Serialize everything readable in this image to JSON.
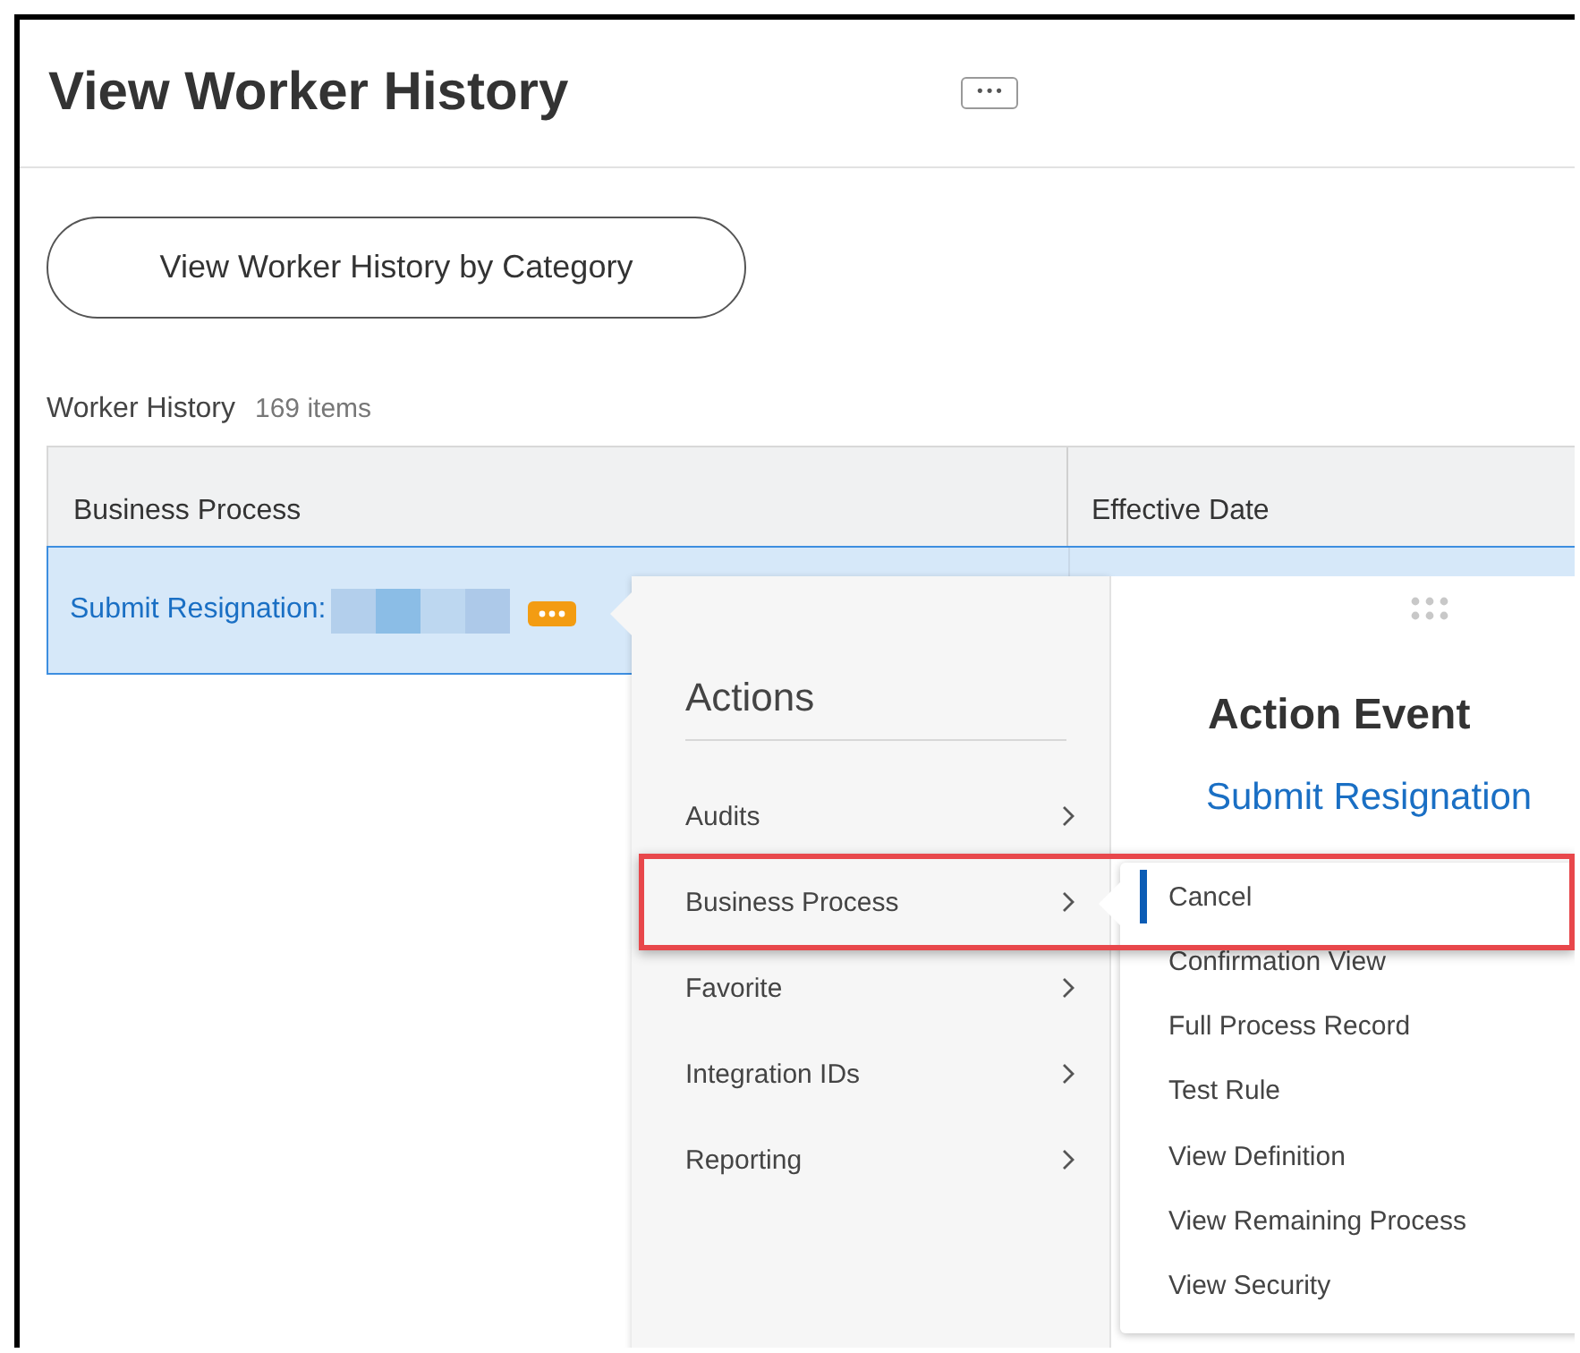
{
  "page": {
    "title": "View Worker History",
    "more_button": "•••"
  },
  "category_button": "View Worker History by Category",
  "grid": {
    "title": "Worker History",
    "count": "169 items",
    "columns": [
      "Business Process",
      "Effective Date"
    ],
    "rows": [
      {
        "link": "Submit Resignation:",
        "redacted": true,
        "selected": true
      }
    ]
  },
  "actions_menu": {
    "title": "Actions",
    "items": [
      {
        "label": "Audits",
        "highlighted": false
      },
      {
        "label": "Business Process",
        "highlighted": true
      },
      {
        "label": "Favorite",
        "highlighted": false
      },
      {
        "label": "Integration IDs",
        "highlighted": false
      },
      {
        "label": "Reporting",
        "highlighted": false
      }
    ]
  },
  "detail": {
    "heading": "Action Event",
    "link": "Submit Resignation"
  },
  "submenu": {
    "items": [
      {
        "label": "Cancel",
        "selected": true
      },
      {
        "label": "Confirmation View",
        "selected": false
      },
      {
        "label": "Full Process Record",
        "selected": false
      },
      {
        "label": "Test Rule",
        "selected": false
      },
      {
        "label": "View Definition",
        "selected": false
      },
      {
        "label": "View Remaining Process",
        "selected": false
      },
      {
        "label": "View Security",
        "selected": false
      }
    ]
  }
}
